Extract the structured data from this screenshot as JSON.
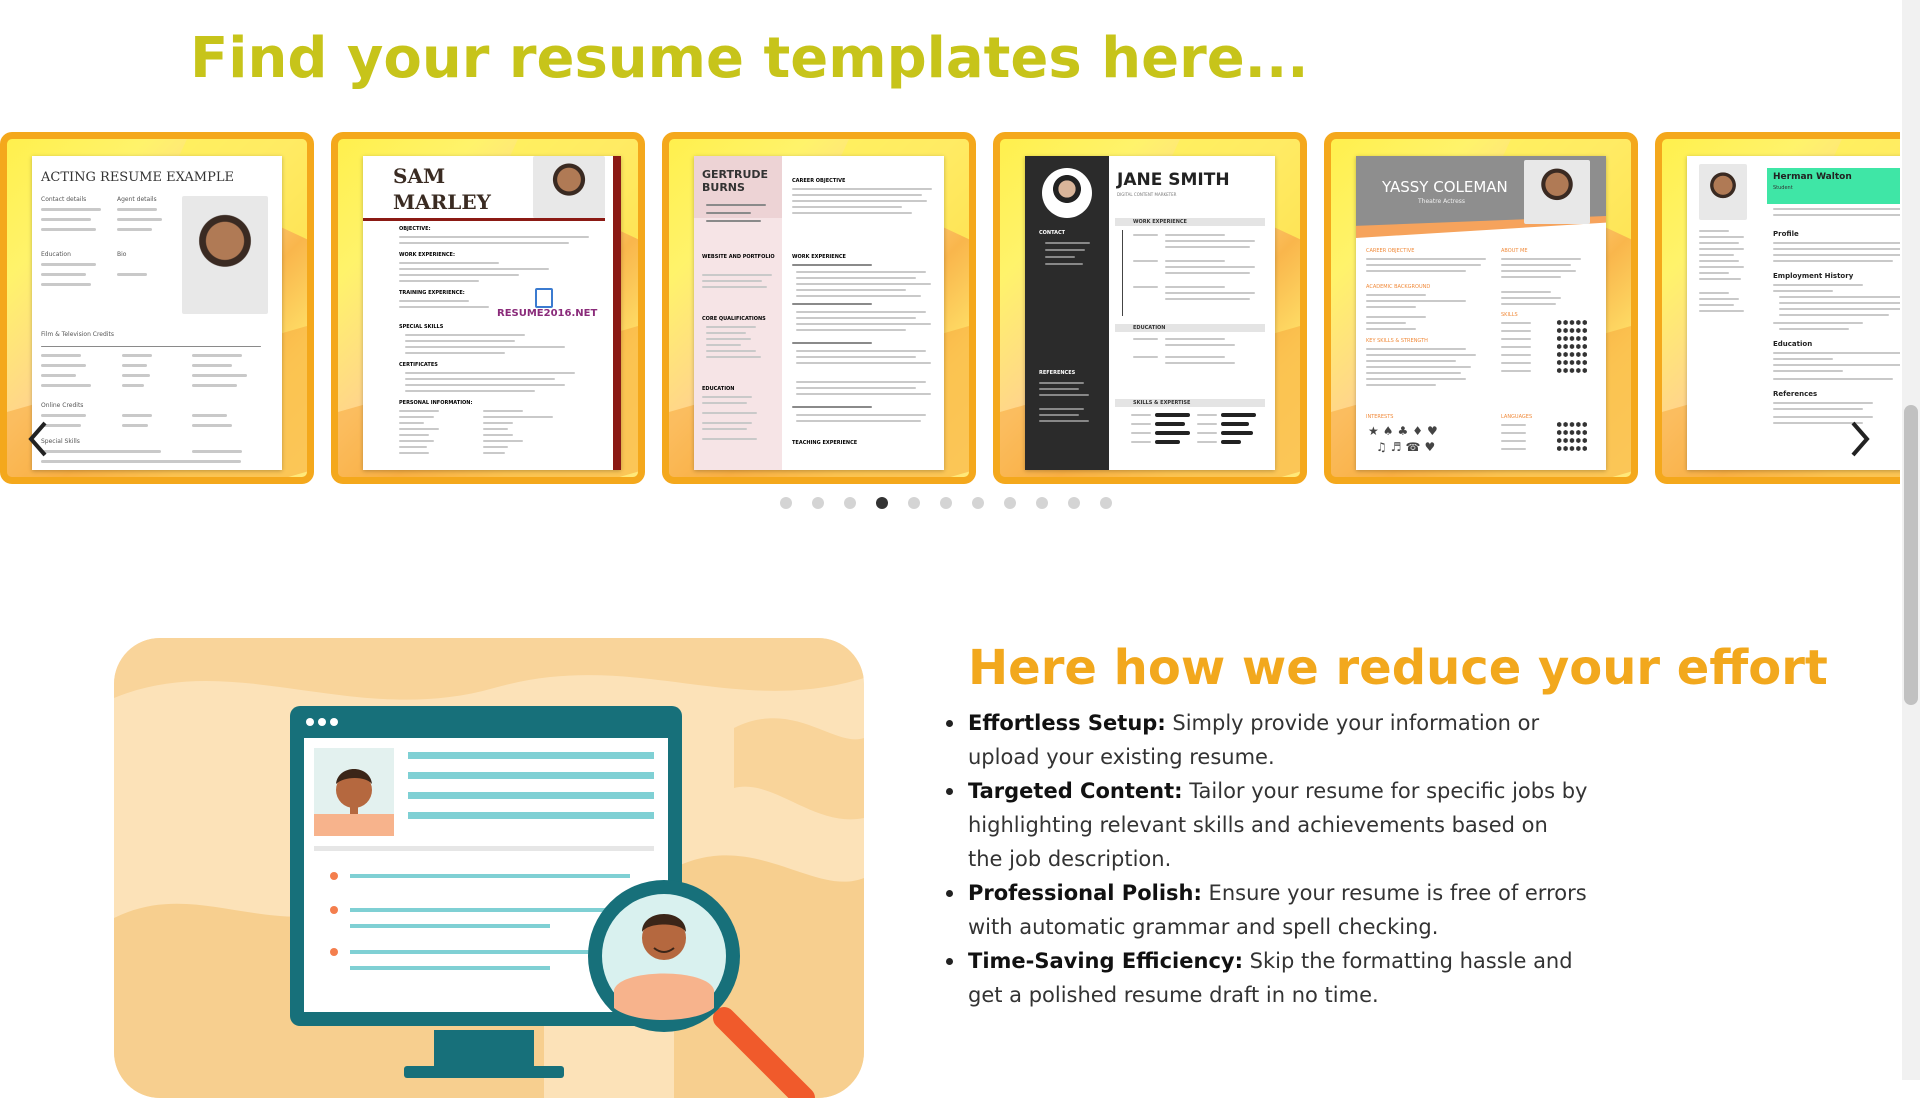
{
  "heading": "Find your resume templates here...",
  "carousel": {
    "cards": [
      {
        "title": "ACTING RESUME EXAMPLE",
        "labels": [
          "Contact details",
          "Agent details",
          "Education",
          "Bio",
          "Film & Television Credits",
          "Online Credits",
          "Special Skills"
        ]
      },
      {
        "name_line1": "SAM",
        "name_line2": "MARLEY",
        "watermark": "RESUME2016.NET",
        "sections": [
          "OBJECTIVE:",
          "WORK EXPERIENCE:",
          "TRAINING EXPERIENCE:",
          "SPECIAL SKILLS",
          "CERTIFICATES",
          "PERSONAL INFORMATION:"
        ]
      },
      {
        "name_line1": "GERTRUDE",
        "name_line2": "BURNS",
        "sections": [
          "CAREER OBJECTIVE",
          "WEBSITE AND PORTFOLIO",
          "WORK EXPERIENCE",
          "CORE QUALIFICATIONS",
          "EDUCATION",
          "TEACHING EXPERIENCE"
        ]
      },
      {
        "name": "JANE SMITH",
        "subtitle": "DIGITAL CONTENT MARKETER",
        "sections": [
          "CONTACT",
          "WORK EXPERIENCE",
          "EDUCATION",
          "REFERENCES",
          "SKILLS & EXPERTISE"
        ]
      },
      {
        "name": "YASSY COLEMAN",
        "subtitle": "Theatre Actress",
        "sections": [
          "CAREER OBJECTIVE",
          "ABOUT ME",
          "ACADEMIC BACKGROUND",
          "SKILLS",
          "KEY SKILLS & STRENGTH",
          "INTERESTS",
          "LANGUAGES"
        ]
      },
      {
        "name": "Herman Walton",
        "subtitle": "Student",
        "sections": [
          "Profile",
          "Employment History",
          "Education",
          "References"
        ]
      }
    ],
    "prev_label": "previous",
    "next_label": "next",
    "slide_count": 11,
    "active_slide": 4
  },
  "section2": {
    "heading": "Here how we reduce your effort",
    "items": [
      {
        "bold": "Effortless Setup:",
        "text": " Simply provide your information or upload your existing resume."
      },
      {
        "bold": "Targeted Content:",
        "text": " Tailor your resume for specific jobs by highlighting relevant skills and achievements based on the job description."
      },
      {
        "bold": "Professional Polish:",
        "text": " Ensure your resume is free of errors with automatic grammar and spell checking."
      },
      {
        "bold": "Time-Saving Efficiency:",
        "text": " Skip the formatting hassle and get a polished resume draft in no time."
      }
    ]
  },
  "colors": {
    "heading": "#c7c41a",
    "accent": "#f2a81d",
    "card_border": "#f4a81c",
    "teal": "#17707a"
  }
}
